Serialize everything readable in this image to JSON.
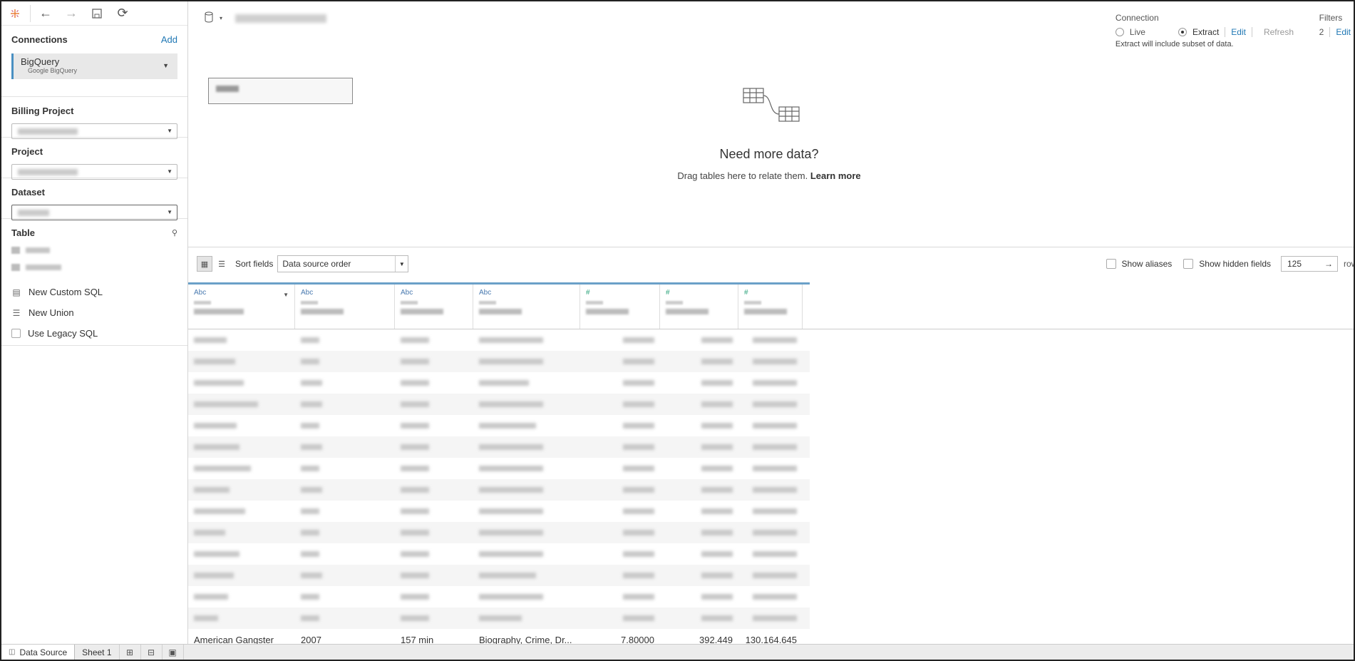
{
  "sidebar": {
    "connections_title": "Connections",
    "add_label": "Add",
    "connection": {
      "name": "BigQuery",
      "type": "Google BigQuery"
    },
    "billing_project_title": "Billing Project",
    "project_title": "Project",
    "dataset_title": "Dataset",
    "table_title": "Table",
    "actions": {
      "custom_sql": "New Custom SQL",
      "new_union": "New Union",
      "legacy_sql": "Use Legacy SQL"
    }
  },
  "canvas": {
    "need_more": "Need more data?",
    "drag_text": "Drag tables here to relate them.",
    "learn_more": "Learn more"
  },
  "connection": {
    "title": "Connection",
    "live": "Live",
    "extract": "Extract",
    "selected": "Extract",
    "edit": "Edit",
    "refresh": "Refresh",
    "note": "Extract will include subset of data."
  },
  "filters": {
    "title": "Filters",
    "count": "2",
    "edit": "Edit"
  },
  "grid_toolbar": {
    "sort_label": "Sort fields",
    "sort_value": "Data source order",
    "show_aliases": "Show aliases",
    "show_hidden": "Show hidden fields",
    "rows_value": "125",
    "rows_label": "row"
  },
  "grid": {
    "columns": [
      {
        "type": "Abc"
      },
      {
        "type": "Abc"
      },
      {
        "type": "Abc"
      },
      {
        "type": "Abc"
      },
      {
        "type": "#"
      },
      {
        "type": "#"
      },
      {
        "type": "#"
      }
    ],
    "last_row": [
      "American Gangster",
      "2007",
      "157 min",
      "Biography, Crime, Dr...",
      "7.80000",
      "392.449",
      "130.164.645"
    ]
  },
  "tabs": {
    "data_source": "Data Source",
    "sheet1": "Sheet 1"
  }
}
